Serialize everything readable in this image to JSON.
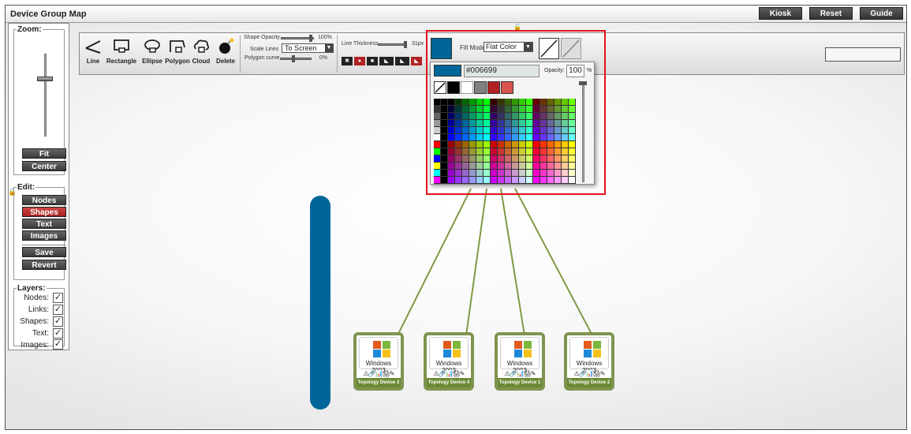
{
  "window": {
    "title": "Device Group Map"
  },
  "topbuttons": {
    "kiosk": "Kiosk",
    "reset": "Reset",
    "guide": "Guide"
  },
  "zoom": {
    "label": "Zoom:",
    "fit": "Fit",
    "center": "Center"
  },
  "edit": {
    "label": "Edit:",
    "nodes": "Nodes",
    "shapes": "Shapes",
    "text": "Text",
    "images": "Images",
    "save": "Save",
    "revert": "Revert",
    "active": "Shapes"
  },
  "layers": {
    "label": "Layers:",
    "items": [
      {
        "label": "Nodes:",
        "checked": true
      },
      {
        "label": "Links:",
        "checked": true
      },
      {
        "label": "Shapes:",
        "checked": true
      },
      {
        "label": "Text:",
        "checked": true
      },
      {
        "label": "Images:",
        "checked": true
      }
    ]
  },
  "tools": {
    "line": "Line",
    "rectangle": "Rectangle",
    "ellipse": "Ellipse",
    "polygon": "Polygon",
    "cloud": "Cloud",
    "delete": "Delete"
  },
  "shape_settings": {
    "shape_opacity_label": "Shape Opacity",
    "shape_opacity_value": "100%",
    "scale_lines_label": "Scale Lines",
    "scale_lines_value": "To Screen",
    "polygon_curve_label": "Polygon curve",
    "polygon_curve_value": "0%"
  },
  "line_thickness": {
    "label": "Line Thickness",
    "value": "31px"
  },
  "fill": {
    "mode_label": "Fill Mode",
    "mode_value": "Flat Color",
    "color": "#006699"
  },
  "color_picker": {
    "hex_value": "#006699",
    "opacity_label": "Opacity:",
    "opacity_value": "100",
    "opacity_unit": "%",
    "swatches": [
      "none",
      "#000000",
      "#ffffff",
      "#808080",
      "#b22222",
      "#d9534f"
    ]
  },
  "nodes": [
    {
      "os": "Windows 2003",
      "label": "Topology Device 3"
    },
    {
      "os": "Windows 2003",
      "label": "Topology Device 4"
    },
    {
      "os": "Windows 2003",
      "label": "Topology Device 1"
    },
    {
      "os": "Windows 2003",
      "label": "Topology Device 2"
    }
  ],
  "colors": {
    "accent_red": "#e0151b",
    "active_button": "#b22222",
    "link_green": "#7f9a45",
    "shape_blue": "#006699"
  }
}
